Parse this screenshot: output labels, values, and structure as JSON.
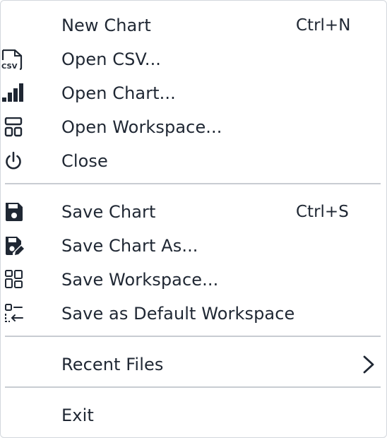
{
  "menu": {
    "items": [
      {
        "label": "New Chart",
        "shortcut": "Ctrl+N",
        "icon": "none"
      },
      {
        "label": "Open CSV...",
        "shortcut": "",
        "icon": "csv-file-icon",
        "icon_text": "CSV"
      },
      {
        "label": "Open Chart...",
        "shortcut": "",
        "icon": "bar-chart-icon"
      },
      {
        "label": "Open Workspace...",
        "shortcut": "",
        "icon": "workspace-layout-icon"
      },
      {
        "label": "Close",
        "shortcut": "",
        "icon": "power-icon"
      },
      {
        "label": "Save Chart",
        "shortcut": "Ctrl+S",
        "icon": "floppy-disk-icon"
      },
      {
        "label": "Save Chart As...",
        "shortcut": "",
        "icon": "floppy-disk-edit-icon"
      },
      {
        "label": "Save Workspace...",
        "shortcut": "",
        "icon": "grid-layout-icon"
      },
      {
        "label": "Save as Default Workspace",
        "shortcut": "",
        "icon": "layout-default-icon"
      },
      {
        "label": "Recent Files",
        "shortcut": "",
        "icon": "chevron-right-icon"
      },
      {
        "label": "Exit",
        "shortcut": "",
        "icon": "none"
      }
    ]
  },
  "colors": {
    "text": "#1f2733",
    "divider": "#c8ccd2",
    "border": "#d3d7dd",
    "background": "#ffffff"
  }
}
